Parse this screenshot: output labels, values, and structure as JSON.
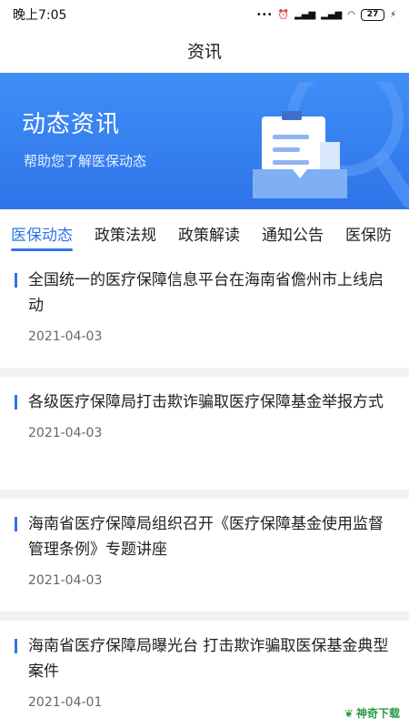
{
  "status_bar": {
    "time": "晚上7:05",
    "battery": "27"
  },
  "header": {
    "title": "资讯"
  },
  "banner": {
    "title": "动态资讯",
    "subtitle": "帮助您了解医保动态"
  },
  "tabs": [
    {
      "label": "医保动态",
      "active": true
    },
    {
      "label": "政策法规",
      "active": false
    },
    {
      "label": "政策解读",
      "active": false
    },
    {
      "label": "通知公告",
      "active": false
    },
    {
      "label": "医保防",
      "active": false
    }
  ],
  "news": [
    {
      "title": "全国统一的医疗保障信息平台在海南省儋州市上线启动",
      "date": "2021-04-03"
    },
    {
      "title": "各级医疗保障局打击欺诈骗取医疗保障基金举报方式",
      "date": "2021-04-03"
    },
    {
      "title": "海南省医疗保障局组织召开《医疗保障基金使用监督管理条例》专题讲座",
      "date": "2021-04-03"
    },
    {
      "title": "海南省医疗保障局曝光台  打击欺诈骗取医保基金典型案件",
      "date": "2021-04-01"
    }
  ],
  "watermark": "神奇下载",
  "colors": {
    "accent": "#2f74ea",
    "banner": "#3f8ef6"
  }
}
